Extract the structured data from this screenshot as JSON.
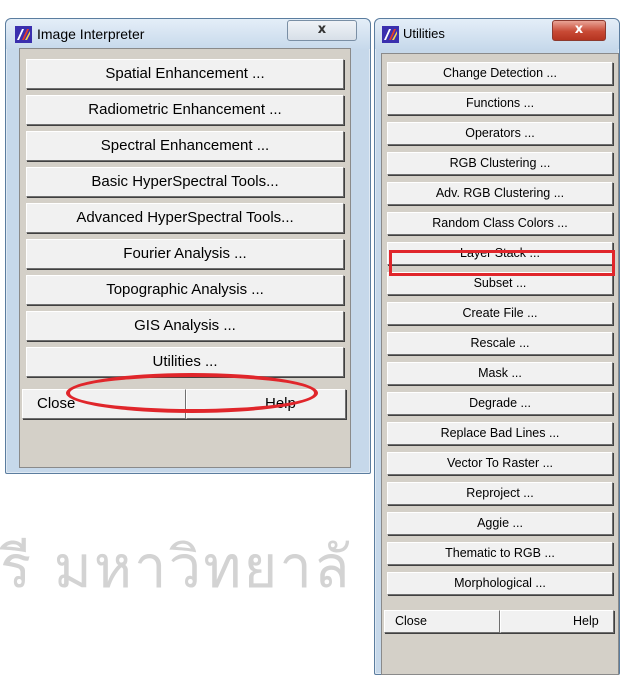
{
  "background": {
    "watermark_text": "รี มหาวิทยาลั"
  },
  "image_interpreter": {
    "title": "Image Interpreter",
    "close_glyph": "x",
    "buttons": [
      "Spatial Enhancement ...",
      "Radiometric Enhancement ...",
      "Spectral Enhancement ...",
      "Basic HyperSpectral Tools...",
      "Advanced HyperSpectral Tools...",
      "Fourier Analysis ...",
      "Topographic Analysis ...",
      "GIS Analysis ...",
      "Utilities ..."
    ],
    "close_label": "Close",
    "help_label": "Help"
  },
  "utilities": {
    "title": "Utilities",
    "close_glyph": "x",
    "buttons": [
      "Change Detection ...",
      "Functions ...",
      "Operators ...",
      "RGB Clustering ...",
      "Adv. RGB Clustering ...",
      "Random Class Colors ...",
      "Layer Stack ...",
      "Subset ...",
      "Create File ...",
      "Rescale ...",
      "Mask ...",
      "Degrade ...",
      "Replace Bad Lines ...",
      "Vector To Raster ...",
      "Reproject ...",
      "Aggie ...",
      "Thematic to RGB ...",
      "Morphological ..."
    ],
    "close_label": "Close",
    "help_label": "Help"
  },
  "annotations": {
    "highlight_color": "#e0262b",
    "circled_item": "Utilities ...",
    "boxed_item": "Layer Stack ..."
  },
  "icons": {
    "app_icon": "erdas-imagine-icon"
  }
}
